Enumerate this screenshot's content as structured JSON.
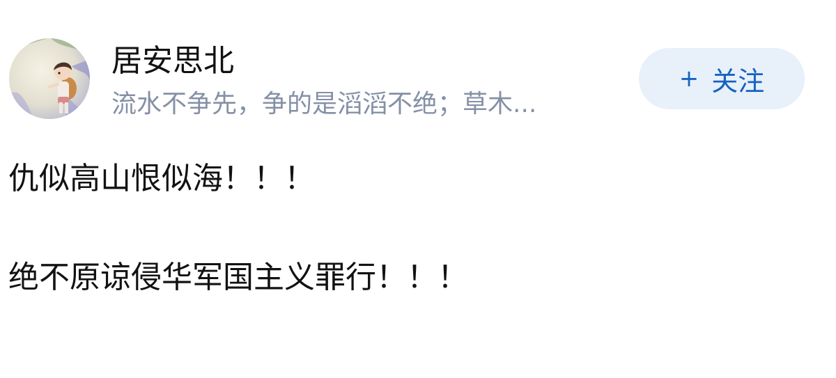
{
  "author": {
    "name": "居安思北",
    "bio": "流水不争先，争的是滔滔不绝；草木..."
  },
  "follow_button": {
    "plus": "+",
    "label": "关注"
  },
  "post": {
    "paragraphs": [
      "仇似高山恨似海！！！",
      "绝不原谅侵华军国主义罪行！！！"
    ]
  },
  "colors": {
    "bio_text": "#8590a6",
    "follow_bg": "#e8f0fa",
    "follow_text": "#1762c1",
    "body_text": "#121212"
  }
}
